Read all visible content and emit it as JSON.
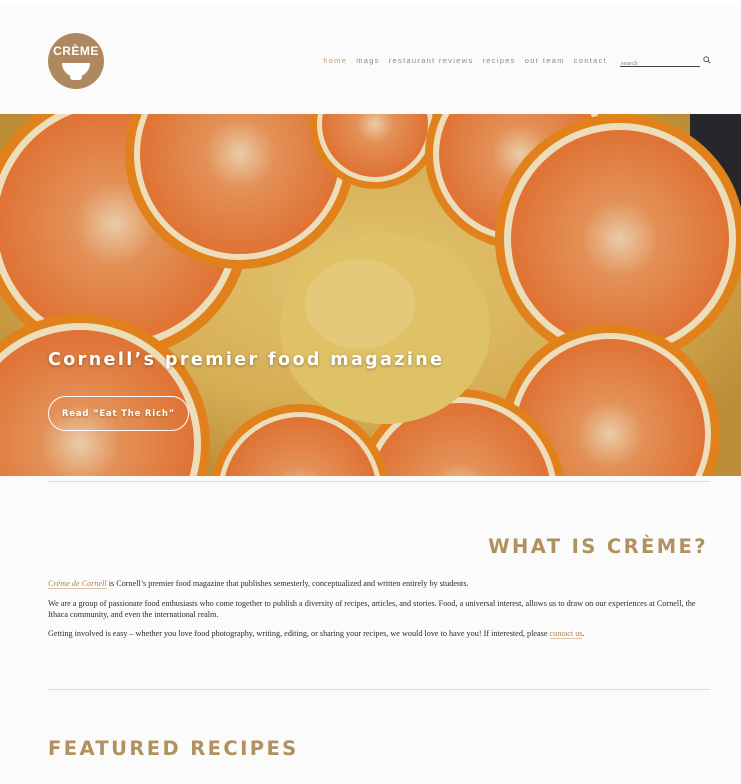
{
  "brand": {
    "logo_text": "CRÈME",
    "accent_color": "#b08860",
    "heading_color": "#b0915f"
  },
  "nav": {
    "items": [
      {
        "label": "home",
        "active": true
      },
      {
        "label": "mags",
        "active": false
      },
      {
        "label": "restaurant reviews",
        "active": false
      },
      {
        "label": "recipes",
        "active": false
      },
      {
        "label": "our team",
        "active": false
      },
      {
        "label": "contact",
        "active": false
      }
    ]
  },
  "search": {
    "placeholder": "search",
    "icon": "search-icon"
  },
  "hero": {
    "title": "Cornell’s premier food magazine",
    "button_label": "Read “Eat The Rich”"
  },
  "about": {
    "heading": "WHAT IS CRÈME?",
    "p1_link": "Crème de Cornell",
    "p1_rest": " is Cornell’s premier food magazine that publishes semesterly, conceptualized and written entirely by students.",
    "p2": "We are a group of passionate food enthusiasts who come together to publish a diversity of recipes, articles, and stories. Food, a universal interest, allows us to draw on our experiences at Cornell, the Ithaca community, and even the international realm.",
    "p3_text": "Getting involved is easy – whether you love food photography, writing, editing, or sharing your recipes, we would love to have you! If interested, please ",
    "p3_link": "contact us",
    "p3_end": "."
  },
  "featured": {
    "heading": "FEATURED RECIPES"
  }
}
